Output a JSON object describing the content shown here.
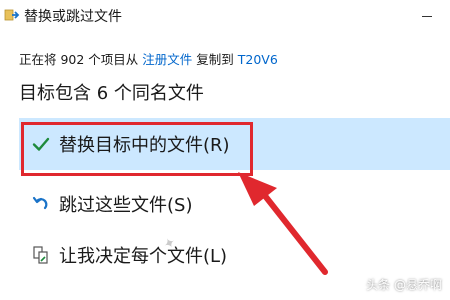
{
  "window": {
    "title": "替换或跳过文件"
  },
  "copy_info": {
    "prefix": "正在将 902 个项目从 ",
    "source": "注册文件",
    "middle": " 复制到 ",
    "destination": "T20V6"
  },
  "conflict": {
    "heading": "目标包含 6 个同名文件"
  },
  "options": {
    "replace_label": "替换目标中的文件(R)",
    "skip_label": "跳过这些文件(S)",
    "decide_label": "让我决定每个文件(L)"
  },
  "watermark": {
    "text": "头条 @悬乔啊"
  },
  "colors": {
    "selected_bg": "#cce8ff",
    "highlight_red": "#e0282e",
    "link_blue": "#0066cc",
    "check_green": "#1e8a3c"
  }
}
